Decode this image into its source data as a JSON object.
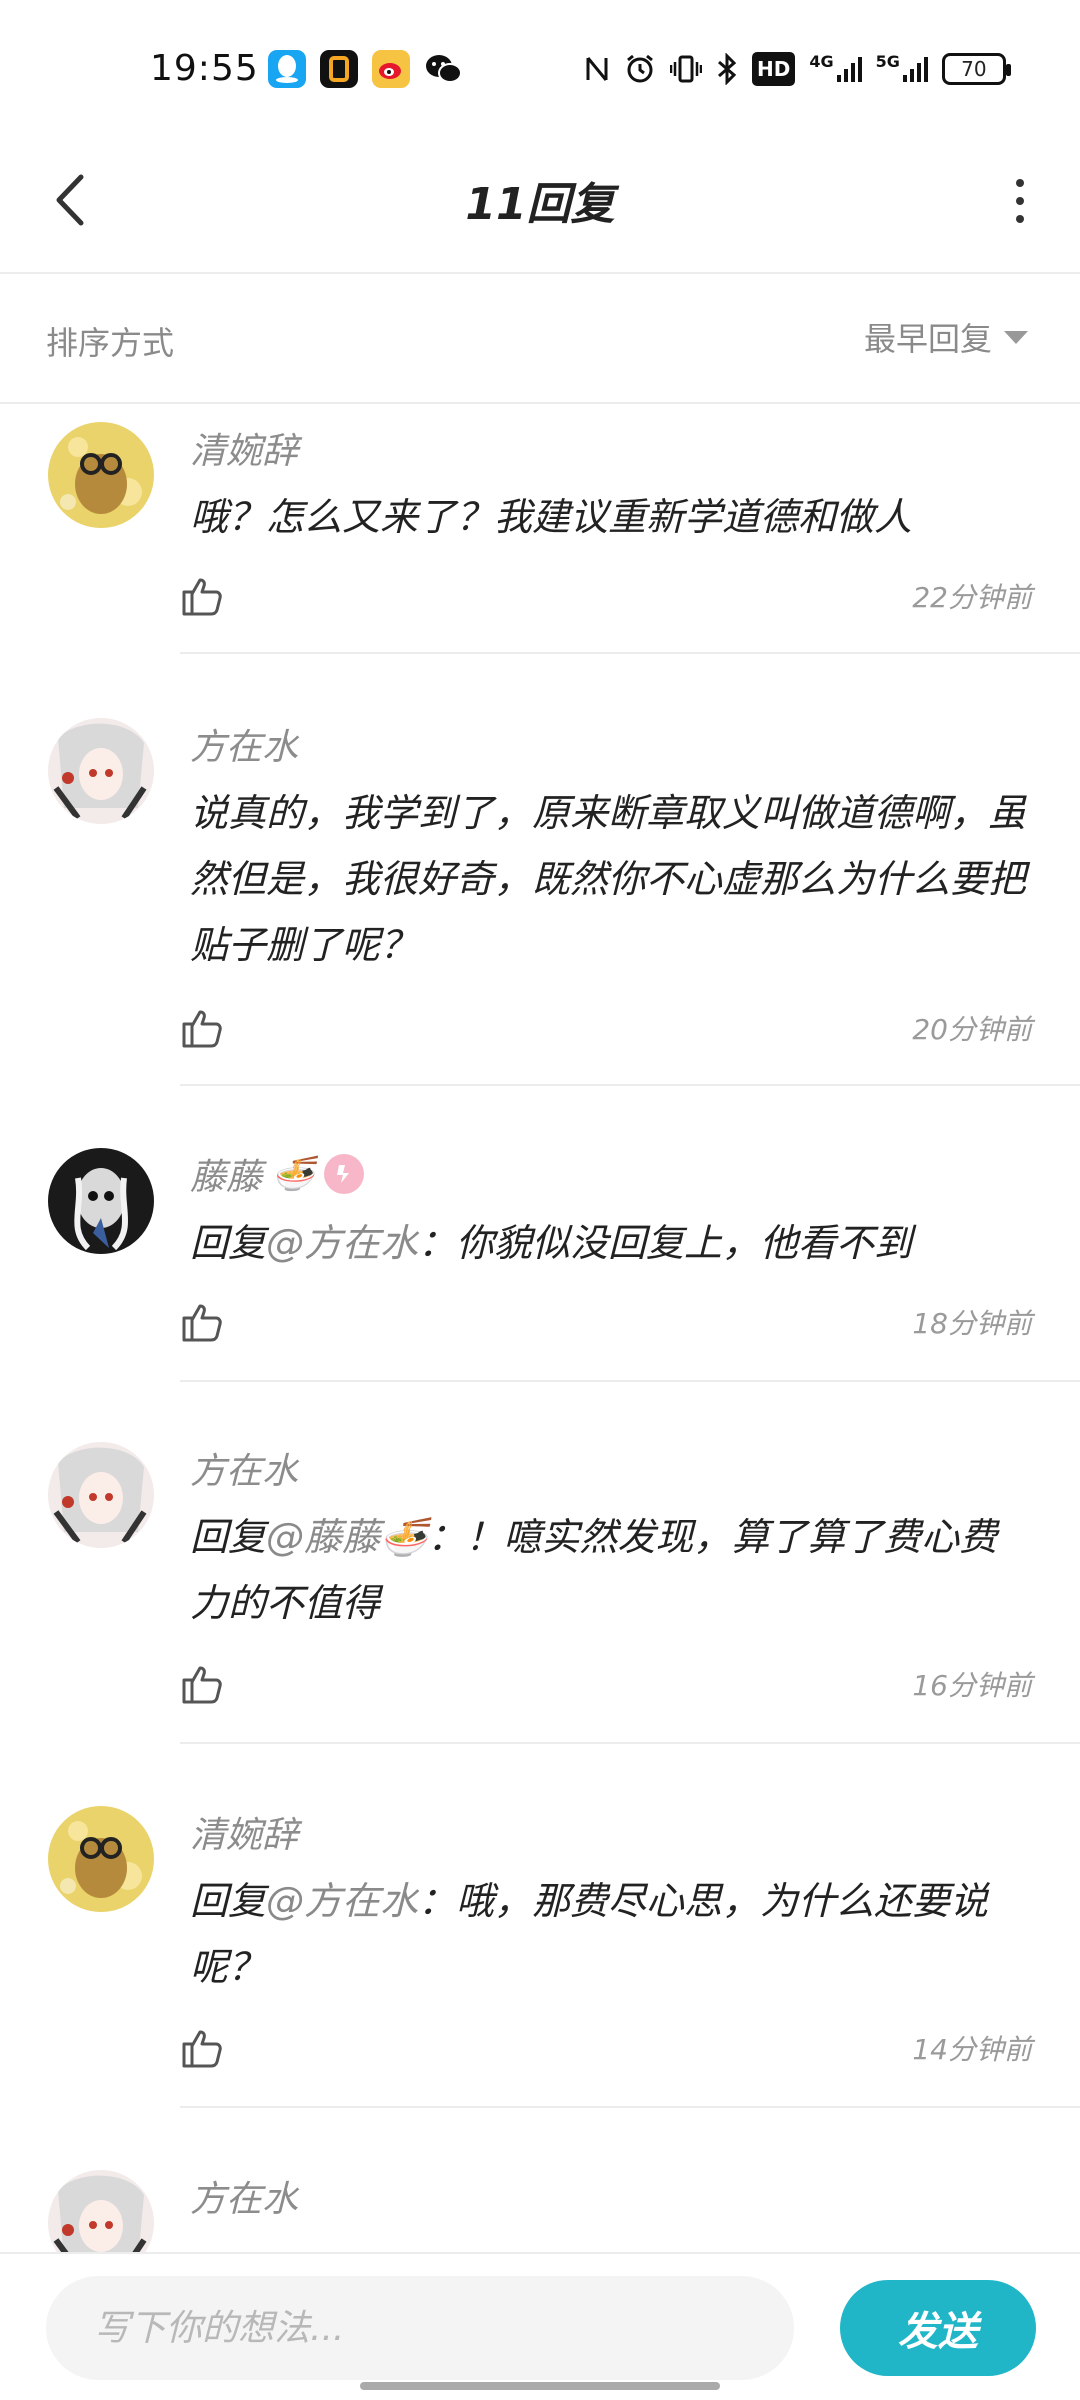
{
  "status_bar": {
    "time": "19:55",
    "battery": "70",
    "network_labels": [
      "4G",
      "5G"
    ],
    "hd_label": "HD"
  },
  "header": {
    "title": "11回复"
  },
  "sort": {
    "label": "排序方式",
    "value": "最早回复"
  },
  "comments": [
    {
      "username": "清婉辞",
      "content": "哦？怎么又来了？我建议重新学道德和做人",
      "mention": "",
      "time": "22分钟前"
    },
    {
      "username": "方在水",
      "content": "说真的，我学到了，原来断章取义叫做道德啊，虽然但是，我很好奇，既然你不心虚那么为什么要把贴子删了呢？",
      "mention": "",
      "time": "20分钟前"
    },
    {
      "username": "藤藤",
      "username_badge": "🍜",
      "content_prefix": "回复",
      "mention": "@方在水",
      "content": "：你貌似没回复上，他看不到",
      "time": "18分钟前"
    },
    {
      "username": "方在水",
      "content_prefix": "回复",
      "mention": "@藤藤🍜",
      "content": "：！噫实然发现，算了算了费心费力的不值得",
      "time": "16分钟前"
    },
    {
      "username": "清婉辞",
      "content_prefix": "回复",
      "mention": "@方在水",
      "content": "：哦，那费尽心思，为什么还要说呢？",
      "time": "14分钟前"
    },
    {
      "username": "方在水",
      "content": "",
      "time": ""
    }
  ],
  "input": {
    "placeholder": "写下你的想法...",
    "send_label": "发送"
  },
  "colors": {
    "accent": "#20b6c8",
    "muted_text": "#8c8c8c"
  }
}
